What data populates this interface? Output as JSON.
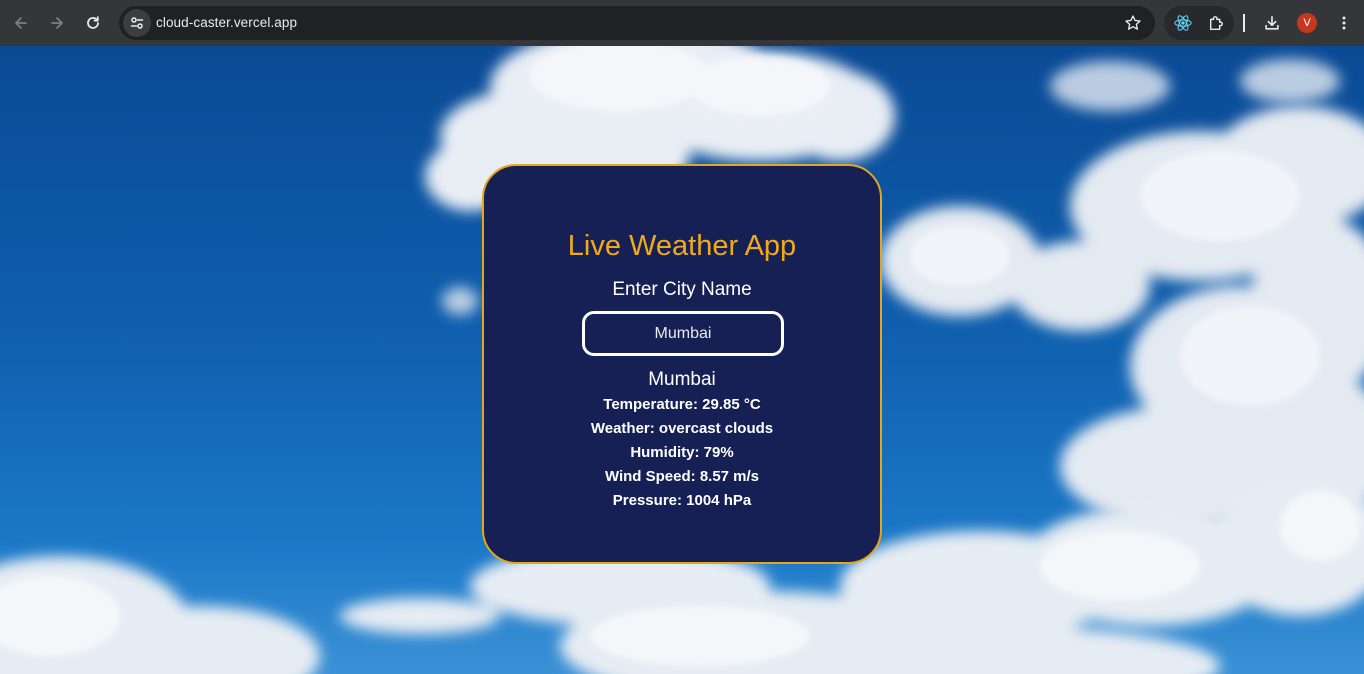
{
  "browser": {
    "url": "cloud-caster.vercel.app",
    "profile_initial": "V",
    "icons": {
      "back": "arrow-left-icon",
      "forward": "arrow-right-icon",
      "reload": "reload-icon",
      "site_info": "tune-icon",
      "bookmark": "star-icon",
      "react_devtools": "react-icon",
      "extensions": "puzzle-icon",
      "downloads": "download-icon",
      "menu": "kebab-menu-icon"
    },
    "colors": {
      "toolbar": "#35363a",
      "omnibox": "#202124",
      "avatar": "#c4391d"
    }
  },
  "app": {
    "title": "Live Weather App",
    "input_label": "Enter City Name",
    "city_input": {
      "value": "Mumbai",
      "placeholder": ""
    },
    "result": {
      "city": "Mumbai",
      "temperature": "Temperature: 29.85 °C",
      "weather": "Weather: overcast clouds",
      "humidity": "Humidity: 79%",
      "wind_speed": "Wind Speed: 8.57 m/s",
      "pressure": "Pressure: 1004 hPa"
    },
    "colors": {
      "card_background": "#172054",
      "card_border": "#e0a81a",
      "title": "#f0aa18",
      "text": "#ffffff"
    }
  }
}
